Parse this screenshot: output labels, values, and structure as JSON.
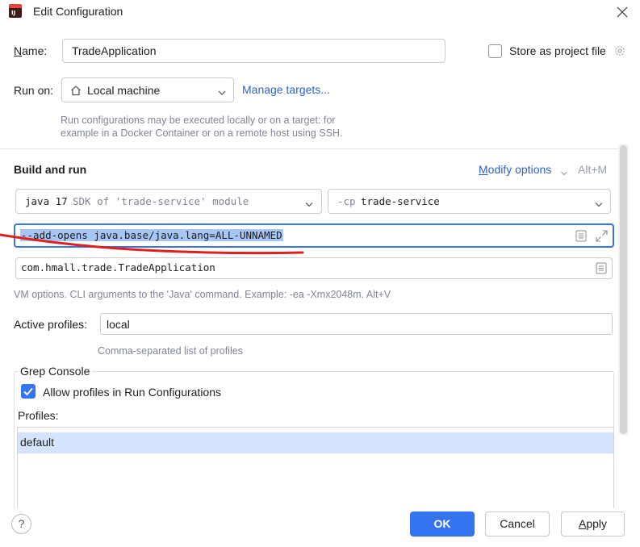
{
  "window": {
    "title": "Edit Configuration"
  },
  "name": {
    "label": "Name:",
    "value": "TradeApplication"
  },
  "store": {
    "label": "Store as project file",
    "checked": false
  },
  "run_on": {
    "label": "Run on:",
    "value": "Local machine",
    "manage_link": "Manage targets...",
    "hint": "Run configurations may be executed locally or on a target: for example in a Docker Container or on a remote host using SSH."
  },
  "build": {
    "title": "Build and run",
    "modify_options": "Modify options",
    "modify_shortcut": "Alt+M",
    "sdk_main": "java 17",
    "sdk_sub": "SDK of 'trade-service' module",
    "cp_prefix": "-cp",
    "cp_value": "trade-service",
    "vm_options": "--add-opens java.base/java.lang=ALL-UNNAMED",
    "main_class": "com.hmall.trade.TradeApplication",
    "vm_hint": "VM options. CLI arguments to the 'Java' command. Example: -ea -Xmx2048m. Alt+V"
  },
  "profiles": {
    "label": "Active profiles:",
    "value": "local",
    "hint": "Comma-separated list of profiles"
  },
  "grep": {
    "title": "Grep Console",
    "allow_label": "Allow profiles in Run Configurations",
    "allow_checked": true,
    "profiles_label": "Profiles:",
    "items": [
      "default"
    ]
  },
  "footer": {
    "help": "?",
    "ok": "OK",
    "cancel": "Cancel",
    "apply": "Apply"
  },
  "icons": {
    "app": "intellij-icon",
    "close": "close-icon",
    "gear": "gear-icon",
    "home": "home-icon",
    "chevron": "chevron-down-icon",
    "doc": "document-icon",
    "expand": "expand-icon",
    "check": "check-icon"
  },
  "colors": {
    "accent": "#3574f0",
    "link": "#2e62c9",
    "selection": "#a6c7f5",
    "list_selection": "#d5e4fc",
    "annotation": "#e02020"
  }
}
